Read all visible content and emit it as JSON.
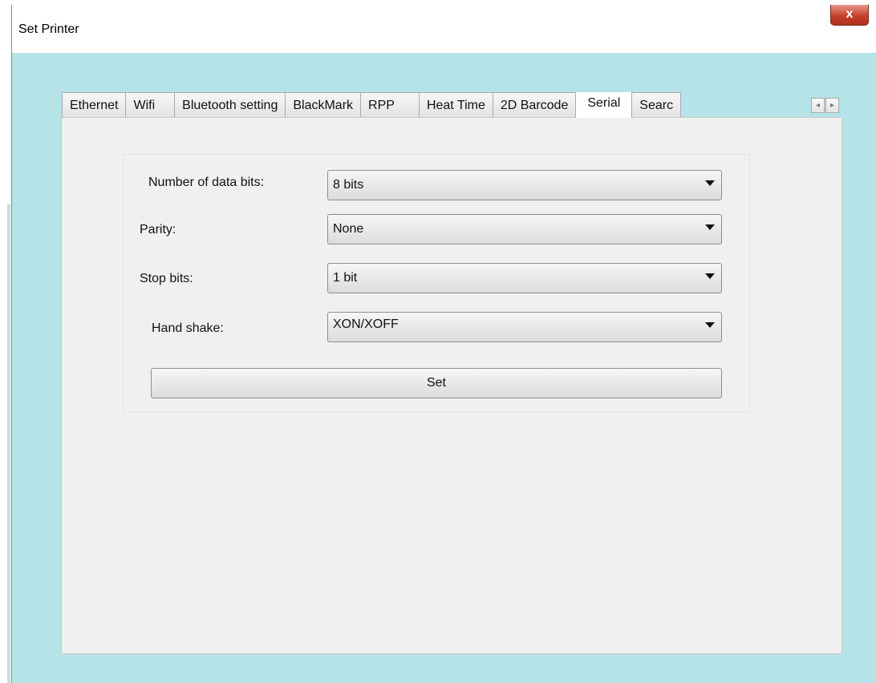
{
  "window": {
    "title": "Set Printer",
    "close_label": "x"
  },
  "tabs": [
    {
      "label": "Ethernet",
      "active": false
    },
    {
      "label": "Wifi",
      "active": false
    },
    {
      "label": "Bluetooth setting",
      "active": false
    },
    {
      "label": "BlackMark",
      "active": false
    },
    {
      "label": "RPP",
      "active": false
    },
    {
      "label": "Heat Time",
      "active": false
    },
    {
      "label": "2D Barcode",
      "active": false
    },
    {
      "label": "Serial",
      "active": true
    },
    {
      "label": "Searc",
      "active": false
    }
  ],
  "tab_scroll": {
    "left_icon": "◂",
    "right_icon": "▸"
  },
  "serial": {
    "data_bits_label": "Number of data bits:",
    "data_bits_value": "8 bits",
    "parity_label": "Parity:",
    "parity_value": "None",
    "stop_bits_label": "Stop bits:",
    "stop_bits_value": "1 bit",
    "handshake_label": "Hand shake:",
    "handshake_value": "XON/XOFF",
    "set_label": "Set"
  }
}
